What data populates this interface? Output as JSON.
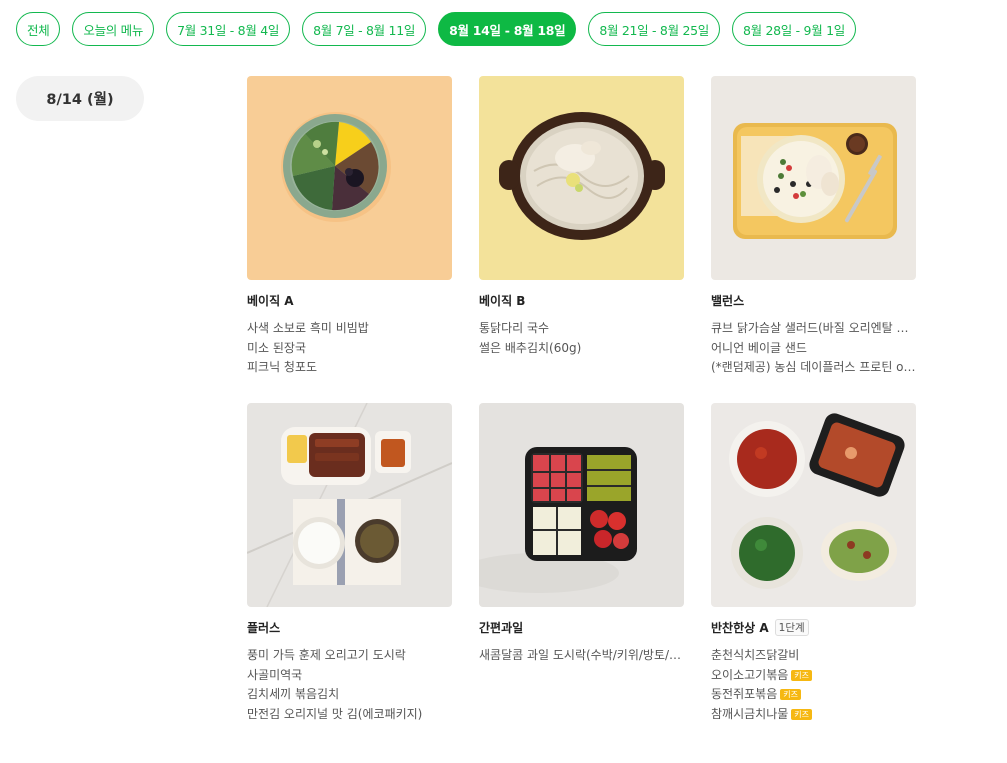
{
  "tabs": [
    {
      "label": "전체",
      "active": false
    },
    {
      "label": "오늘의 메뉴",
      "active": false
    },
    {
      "label": "7월 31일 - 8월 4일",
      "active": false
    },
    {
      "label": "8월 7일 - 8월 11일",
      "active": false
    },
    {
      "label": "8월 14일 - 8월 18일",
      "active": true
    },
    {
      "label": "8월 21일 - 8월 25일",
      "active": false
    },
    {
      "label": "8월 28일 - 9월 1일",
      "active": false
    }
  ],
  "date_label": "8/14 (월)",
  "colors": {
    "accent": "#0eb944",
    "kids_badge": "#f6b812"
  },
  "cards": [
    {
      "title": "베이직 A",
      "image": "bibimbap-bowl-image",
      "items": [
        "사색 소보로 흑미 비빔밥",
        "미소 된장국",
        "피크닉 청포도"
      ]
    },
    {
      "title": "베이직 B",
      "image": "chicken-noodle-pot-image",
      "items": [
        "통닭다리 국수",
        "썰은 배추김치(60g)"
      ]
    },
    {
      "title": "밸런스",
      "image": "salad-tray-image",
      "items": [
        "큐브 닭가슴살 샐러드(바질 오리엔탈 드레싱)",
        "어니언 베이글 샌드",
        "(*랜덤제공) 농심 데이플러스 프로틴 or 오트밀크"
      ]
    },
    {
      "title": "플러스",
      "image": "smoked-duck-lunchbox-image",
      "items": [
        "풍미 가득 훈제 오리고기 도시락",
        "사골미역국",
        "김치세끼 볶음김치",
        "만전김 오리지널 맛 김(에코패키지)"
      ]
    },
    {
      "title": "간편과일",
      "image": "fruit-box-image",
      "items": [
        "새콤달콤 과일 도시락(수박/키위/방토/바나나)"
      ]
    },
    {
      "title": "반찬한상 A",
      "badge": "1단계",
      "image": "side-dishes-image",
      "items": [
        {
          "text": "춘천식치즈닭갈비",
          "kids": ""
        },
        {
          "text": "오이소고기볶음",
          "kids": "키즈"
        },
        {
          "text": "동전쥐포볶음",
          "kids": "키즈"
        },
        {
          "text": "참깨시금치나물",
          "kids": "키즈"
        }
      ]
    }
  ]
}
